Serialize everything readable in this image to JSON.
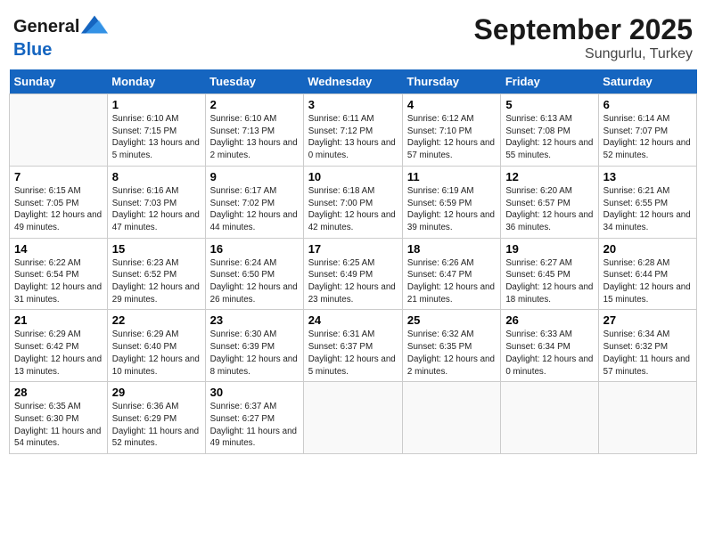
{
  "header": {
    "logo_line1": "General",
    "logo_line2": "Blue",
    "main_title": "September 2025",
    "subtitle": "Sungurlu, Turkey"
  },
  "calendar": {
    "days_of_week": [
      "Sunday",
      "Monday",
      "Tuesday",
      "Wednesday",
      "Thursday",
      "Friday",
      "Saturday"
    ],
    "weeks": [
      [
        {
          "day": "",
          "empty": true
        },
        {
          "day": "1",
          "sunrise": "6:10 AM",
          "sunset": "7:15 PM",
          "daylight": "13 hours and 5 minutes."
        },
        {
          "day": "2",
          "sunrise": "6:10 AM",
          "sunset": "7:13 PM",
          "daylight": "13 hours and 2 minutes."
        },
        {
          "day": "3",
          "sunrise": "6:11 AM",
          "sunset": "7:12 PM",
          "daylight": "13 hours and 0 minutes."
        },
        {
          "day": "4",
          "sunrise": "6:12 AM",
          "sunset": "7:10 PM",
          "daylight": "12 hours and 57 minutes."
        },
        {
          "day": "5",
          "sunrise": "6:13 AM",
          "sunset": "7:08 PM",
          "daylight": "12 hours and 55 minutes."
        },
        {
          "day": "6",
          "sunrise": "6:14 AM",
          "sunset": "7:07 PM",
          "daylight": "12 hours and 52 minutes."
        }
      ],
      [
        {
          "day": "7",
          "sunrise": "6:15 AM",
          "sunset": "7:05 PM",
          "daylight": "12 hours and 49 minutes."
        },
        {
          "day": "8",
          "sunrise": "6:16 AM",
          "sunset": "7:03 PM",
          "daylight": "12 hours and 47 minutes."
        },
        {
          "day": "9",
          "sunrise": "6:17 AM",
          "sunset": "7:02 PM",
          "daylight": "12 hours and 44 minutes."
        },
        {
          "day": "10",
          "sunrise": "6:18 AM",
          "sunset": "7:00 PM",
          "daylight": "12 hours and 42 minutes."
        },
        {
          "day": "11",
          "sunrise": "6:19 AM",
          "sunset": "6:59 PM",
          "daylight": "12 hours and 39 minutes."
        },
        {
          "day": "12",
          "sunrise": "6:20 AM",
          "sunset": "6:57 PM",
          "daylight": "12 hours and 36 minutes."
        },
        {
          "day": "13",
          "sunrise": "6:21 AM",
          "sunset": "6:55 PM",
          "daylight": "12 hours and 34 minutes."
        }
      ],
      [
        {
          "day": "14",
          "sunrise": "6:22 AM",
          "sunset": "6:54 PM",
          "daylight": "12 hours and 31 minutes."
        },
        {
          "day": "15",
          "sunrise": "6:23 AM",
          "sunset": "6:52 PM",
          "daylight": "12 hours and 29 minutes."
        },
        {
          "day": "16",
          "sunrise": "6:24 AM",
          "sunset": "6:50 PM",
          "daylight": "12 hours and 26 minutes."
        },
        {
          "day": "17",
          "sunrise": "6:25 AM",
          "sunset": "6:49 PM",
          "daylight": "12 hours and 23 minutes."
        },
        {
          "day": "18",
          "sunrise": "6:26 AM",
          "sunset": "6:47 PM",
          "daylight": "12 hours and 21 minutes."
        },
        {
          "day": "19",
          "sunrise": "6:27 AM",
          "sunset": "6:45 PM",
          "daylight": "12 hours and 18 minutes."
        },
        {
          "day": "20",
          "sunrise": "6:28 AM",
          "sunset": "6:44 PM",
          "daylight": "12 hours and 15 minutes."
        }
      ],
      [
        {
          "day": "21",
          "sunrise": "6:29 AM",
          "sunset": "6:42 PM",
          "daylight": "12 hours and 13 minutes."
        },
        {
          "day": "22",
          "sunrise": "6:29 AM",
          "sunset": "6:40 PM",
          "daylight": "12 hours and 10 minutes."
        },
        {
          "day": "23",
          "sunrise": "6:30 AM",
          "sunset": "6:39 PM",
          "daylight": "12 hours and 8 minutes."
        },
        {
          "day": "24",
          "sunrise": "6:31 AM",
          "sunset": "6:37 PM",
          "daylight": "12 hours and 5 minutes."
        },
        {
          "day": "25",
          "sunrise": "6:32 AM",
          "sunset": "6:35 PM",
          "daylight": "12 hours and 2 minutes."
        },
        {
          "day": "26",
          "sunrise": "6:33 AM",
          "sunset": "6:34 PM",
          "daylight": "12 hours and 0 minutes."
        },
        {
          "day": "27",
          "sunrise": "6:34 AM",
          "sunset": "6:32 PM",
          "daylight": "11 hours and 57 minutes."
        }
      ],
      [
        {
          "day": "28",
          "sunrise": "6:35 AM",
          "sunset": "6:30 PM",
          "daylight": "11 hours and 54 minutes."
        },
        {
          "day": "29",
          "sunrise": "6:36 AM",
          "sunset": "6:29 PM",
          "daylight": "11 hours and 52 minutes."
        },
        {
          "day": "30",
          "sunrise": "6:37 AM",
          "sunset": "6:27 PM",
          "daylight": "11 hours and 49 minutes."
        },
        {
          "day": "",
          "empty": true
        },
        {
          "day": "",
          "empty": true
        },
        {
          "day": "",
          "empty": true
        },
        {
          "day": "",
          "empty": true
        }
      ]
    ]
  }
}
